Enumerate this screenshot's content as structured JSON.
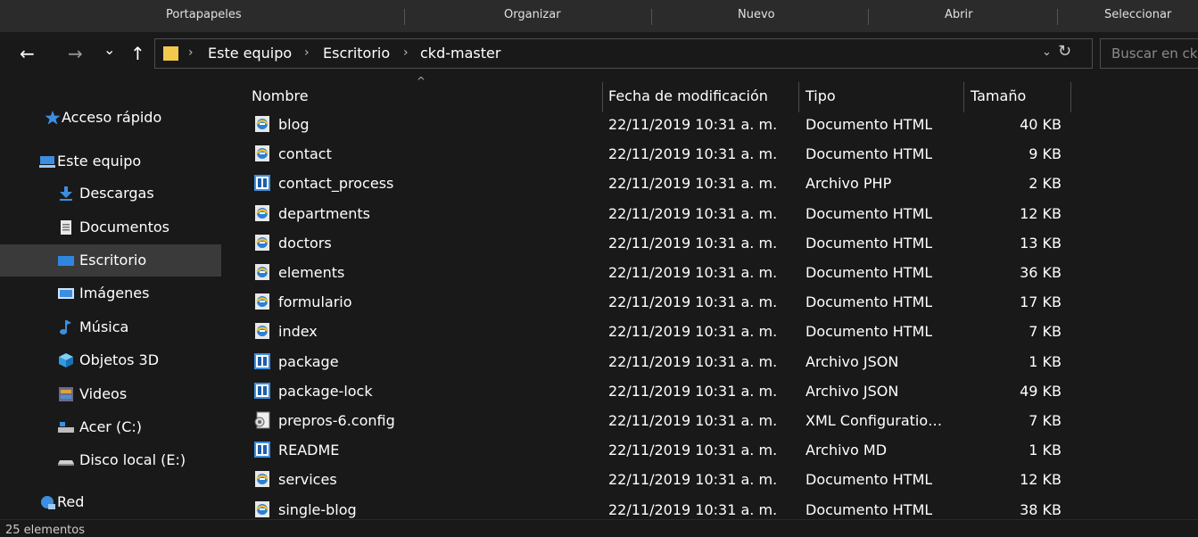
{
  "ribbon": {
    "groups": [
      "Portapapeles",
      "Organizar",
      "Nuevo",
      "Abrir",
      "Seleccionar"
    ]
  },
  "nav": {
    "back": "←",
    "forward": "→",
    "recent": "⌄",
    "up": "↑"
  },
  "address": {
    "crumbs": [
      "Este equipo",
      "Escritorio",
      "ckd-master"
    ],
    "separator": "›",
    "dropdown": "⌄",
    "refresh": "↻"
  },
  "search": {
    "placeholder": "Buscar en ck"
  },
  "sidebar": {
    "items": [
      {
        "label": "Acceso rápido",
        "icon": "star-icon"
      },
      {
        "label": "Este equipo",
        "icon": "computer-icon"
      },
      {
        "label": "Descargas",
        "icon": "download-icon"
      },
      {
        "label": "Documentos",
        "icon": "document-icon"
      },
      {
        "label": "Escritorio",
        "icon": "desktop-icon",
        "selected": true
      },
      {
        "label": "Imágenes",
        "icon": "image-icon"
      },
      {
        "label": "Música",
        "icon": "music-icon"
      },
      {
        "label": "Objetos 3D",
        "icon": "cube-icon"
      },
      {
        "label": "Videos",
        "icon": "film-icon"
      },
      {
        "label": "Acer (C:)",
        "icon": "drive-icon"
      },
      {
        "label": "Disco local (E:)",
        "icon": "disk-icon"
      },
      {
        "label": "Red",
        "icon": "network-icon"
      }
    ]
  },
  "columns": {
    "name": "Nombre",
    "date": "Fecha de modificación",
    "type": "Tipo",
    "size": "Tamaño",
    "sort_indicator": "^"
  },
  "files": [
    {
      "name": "blog",
      "date": "22/11/2019 10:31 a. m.",
      "type": "Documento HTML",
      "size": "40 KB",
      "icon": "html-file-icon"
    },
    {
      "name": "contact",
      "date": "22/11/2019 10:31 a. m.",
      "type": "Documento HTML",
      "size": "9 KB",
      "icon": "html-file-icon"
    },
    {
      "name": "contact_process",
      "date": "22/11/2019 10:31 a. m.",
      "type": "Archivo PHP",
      "size": "2 KB",
      "icon": "code-file-icon"
    },
    {
      "name": "departments",
      "date": "22/11/2019 10:31 a. m.",
      "type": "Documento HTML",
      "size": "12 KB",
      "icon": "html-file-icon"
    },
    {
      "name": "doctors",
      "date": "22/11/2019 10:31 a. m.",
      "type": "Documento HTML",
      "size": "13 KB",
      "icon": "html-file-icon"
    },
    {
      "name": "elements",
      "date": "22/11/2019 10:31 a. m.",
      "type": "Documento HTML",
      "size": "36 KB",
      "icon": "html-file-icon"
    },
    {
      "name": "formulario",
      "date": "22/11/2019 10:31 a. m.",
      "type": "Documento HTML",
      "size": "17 KB",
      "icon": "html-file-icon"
    },
    {
      "name": "index",
      "date": "22/11/2019 10:31 a. m.",
      "type": "Documento HTML",
      "size": "7 KB",
      "icon": "html-file-icon"
    },
    {
      "name": "package",
      "date": "22/11/2019 10:31 a. m.",
      "type": "Archivo JSON",
      "size": "1 KB",
      "icon": "code-file-icon"
    },
    {
      "name": "package-lock",
      "date": "22/11/2019 10:31 a. m.",
      "type": "Archivo JSON",
      "size": "49 KB",
      "icon": "code-file-icon"
    },
    {
      "name": "prepros-6.config",
      "date": "22/11/2019 10:31 a. m.",
      "type": "XML Configuration...",
      "size": "7 KB",
      "icon": "config-file-icon"
    },
    {
      "name": "README",
      "date": "22/11/2019 10:31 a. m.",
      "type": "Archivo MD",
      "size": "1 KB",
      "icon": "code-file-icon"
    },
    {
      "name": "services",
      "date": "22/11/2019 10:31 a. m.",
      "type": "Documento HTML",
      "size": "12 KB",
      "icon": "html-file-icon"
    },
    {
      "name": "single-blog",
      "date": "22/11/2019 10:31 a. m.",
      "type": "Documento HTML",
      "size": "38 KB",
      "icon": "html-file-icon"
    }
  ],
  "status": {
    "text": "25 elementos"
  },
  "colors": {
    "background": "#191919",
    "selected": "#3a3a3a",
    "folder": "#f2c94c",
    "accent_blue": "#3d8ee0"
  }
}
